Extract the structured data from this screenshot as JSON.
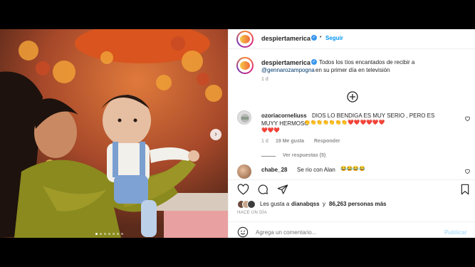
{
  "post": {
    "username": "despiertamerica",
    "follow_label": "Seguir",
    "caption_text": "Todos los tíos encantados de recibir a",
    "caption_mention": "@gennarozampogna",
    "caption_rest": "en su primer día en televisión",
    "caption_time": "1 d"
  },
  "comments": [
    {
      "username": "ozoriacorneliuss",
      "text_line1": "DIOS LO BENDIGA ES MUY SERIO , PERO ES",
      "text_line2": "MUYY HERMOSO",
      "emoji_line1": "👏👏👏👏👏👏👏❤️❤️❤️❤️❤️❤️",
      "emoji_line2": "❤️❤️❤️",
      "time": "1 d",
      "likes": "19 Me gusta",
      "reply_label": "Responder",
      "view_replies": "Ver respuestas (5)"
    },
    {
      "username": "chabe_28",
      "text": "Se rio con Alan",
      "emoji": "😂😂😂😂"
    }
  ],
  "likes": {
    "prefix": "Les gusta a",
    "user": "dianabqss",
    "middle": "y",
    "count": "86,263 personas más"
  },
  "timestamp": "HACE UN DÍA",
  "comment_box": {
    "placeholder": "Agrega un comentario...",
    "publish_label": "Publicar"
  },
  "colors": {
    "link": "#00376b",
    "follow": "#0095f6",
    "publish": "#b2dffc",
    "heart_red": "#e0245e"
  }
}
